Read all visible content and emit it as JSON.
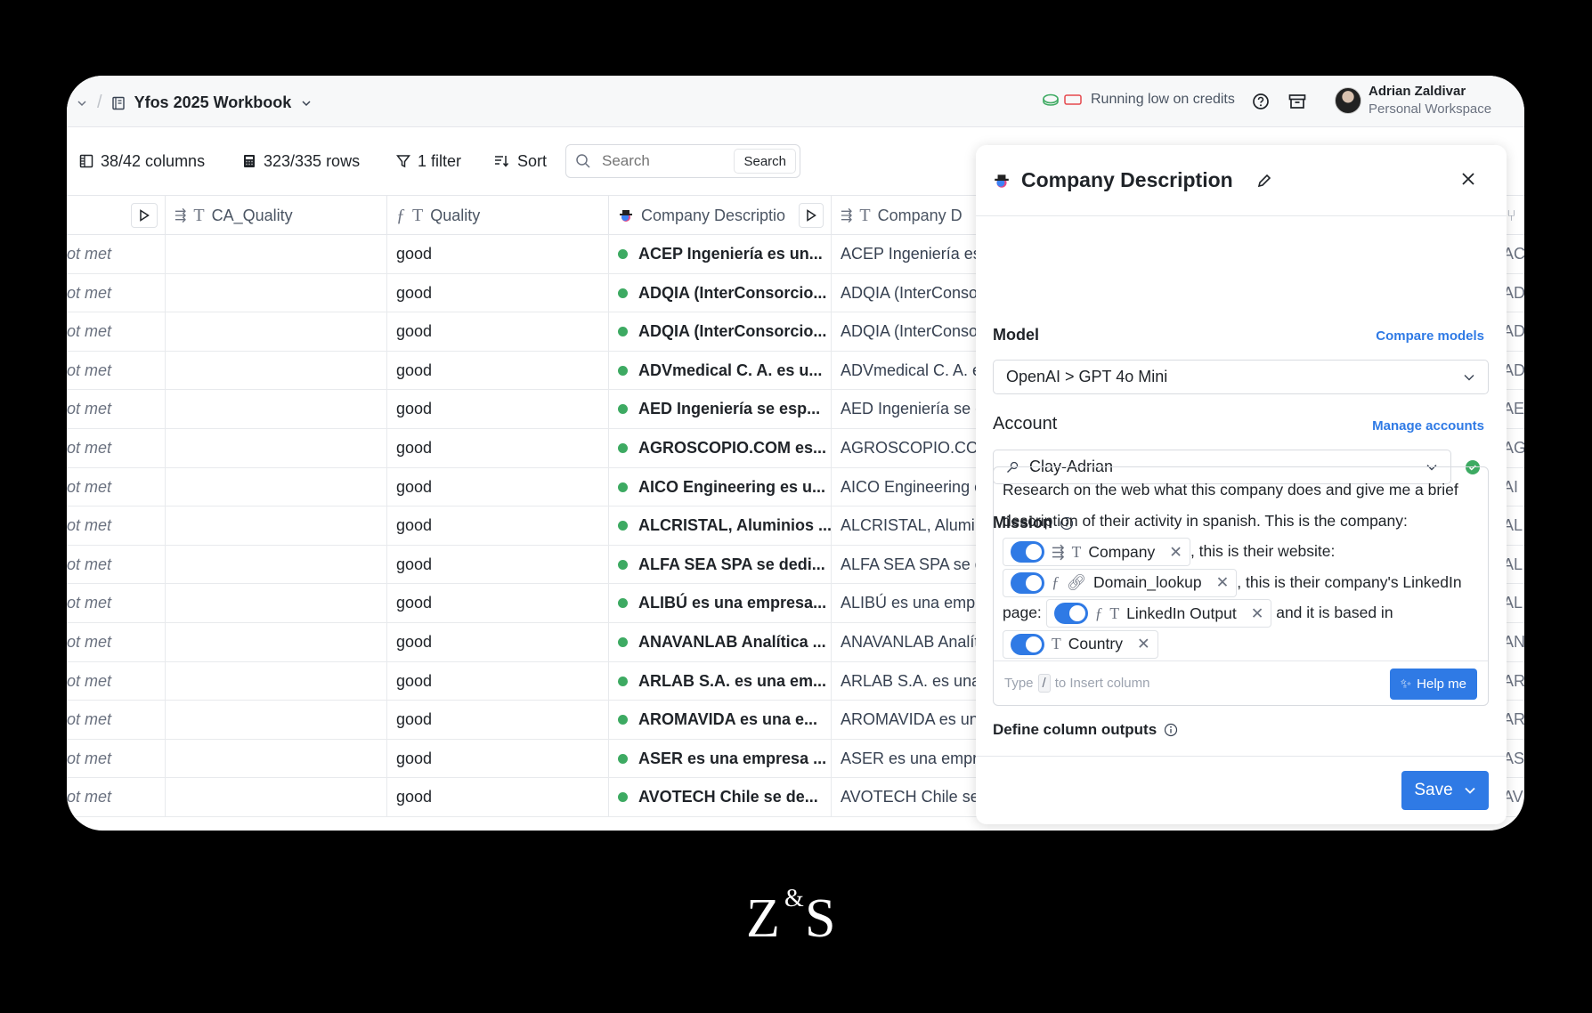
{
  "header": {
    "workbook_title": "Yfos 2025 Workbook",
    "credits_text": "Running low on credits",
    "user_name": "Adrian Zaldivar",
    "workspace": "Personal Workspace"
  },
  "toolbar": {
    "columns": "38/42 columns",
    "rows": "323/335 rows",
    "filter": "1 filter",
    "sort": "Sort",
    "search_placeholder": "Search",
    "search_button": "Search"
  },
  "table": {
    "headers": [
      "CA_Quality",
      "Quality",
      "Company Descriptio",
      "Company D"
    ],
    "rows": [
      {
        "status": "Not met",
        "ca_quality": "",
        "quality": "good",
        "description": "ACEP Ingeniería es un...",
        "company_d": "ACEP Ingeniería es",
        "last": "AC"
      },
      {
        "status": "Not met",
        "ca_quality": "",
        "quality": "good",
        "description": "ADQIA (InterConsorcio...",
        "company_d": "ADQIA (InterConso",
        "last": "AD"
      },
      {
        "status": "Not met",
        "ca_quality": "",
        "quality": "good",
        "description": "ADQIA (InterConsorcio...",
        "company_d": "ADQIA (InterConso",
        "last": "AD"
      },
      {
        "status": "Not met",
        "ca_quality": "",
        "quality": "good",
        "description": "ADVmedical C. A. es u...",
        "company_d": "ADVmedical C. A. e",
        "last": "AD"
      },
      {
        "status": "Not met",
        "ca_quality": "",
        "quality": "good",
        "description": "AED Ingeniería se esp...",
        "company_d": "AED Ingeniería se e",
        "last": "AE"
      },
      {
        "status": "Not met",
        "ca_quality": "",
        "quality": "good",
        "description": "AGROSCOPIO.COM es...",
        "company_d": "AGROSCOPIO.COM",
        "last": "AG"
      },
      {
        "status": "Not met",
        "ca_quality": "",
        "quality": "good",
        "description": "AICO Engineering es u...",
        "company_d": "AICO Engineering e",
        "last": "AI"
      },
      {
        "status": "Not met",
        "ca_quality": "",
        "quality": "good",
        "description": "ALCRISTAL, Aluminios ...",
        "company_d": "ALCRISTAL, Alumin",
        "last": "AL"
      },
      {
        "status": "Not met",
        "ca_quality": "",
        "quality": "good",
        "description": "ALFA SEA SPA se dedi...",
        "company_d": "ALFA SEA SPA se d",
        "last": "AL"
      },
      {
        "status": "Not met",
        "ca_quality": "",
        "quality": "good",
        "description": "ALIBÚ es una empresa...",
        "company_d": "ALIBÚ es una empr",
        "last": "AL"
      },
      {
        "status": "Not met",
        "ca_quality": "",
        "quality": "good",
        "description": "ANAVANLAB Analítica ...",
        "company_d": "ANAVANLAB Analít",
        "last": "AN"
      },
      {
        "status": "Not met",
        "ca_quality": "",
        "quality": "good",
        "description": "ARLAB S.A. es una em...",
        "company_d": "ARLAB S.A. es una",
        "last": "AR"
      },
      {
        "status": "Not met",
        "ca_quality": "",
        "quality": "good",
        "description": "AROMAVIDA es una e...",
        "company_d": "AROMAVIDA es un",
        "last": "AR"
      },
      {
        "status": "Not met",
        "ca_quality": "",
        "quality": "good",
        "description": "ASER es una empresa ...",
        "company_d": "ASER es una empr",
        "last": "AS"
      },
      {
        "status": "Not met",
        "ca_quality": "",
        "quality": "good",
        "description": "AVOTECH Chile se de...",
        "company_d": "AVOTECH Chile se",
        "last": "AV"
      }
    ]
  },
  "panel": {
    "title": "Company Description",
    "model_label": "Model",
    "compare_models": "Compare models",
    "model_value": "OpenAI > GPT 4o Mini",
    "account_label": "Account",
    "manage_accounts": "Manage accounts",
    "account_value": "Clay-Adrian",
    "mission_label": "Mission",
    "mission": {
      "t1": "Research on the web what this company does and give me a brief description of their activity in spanish. This is the company:",
      "chip1": "Company",
      "t2": ", this is their website:",
      "chip2": "Domain_lookup",
      "t3": ", this is their company's LinkedIn page:",
      "chip3": "LinkedIn Output",
      "t4": " and it is based in",
      "chip4": "Country"
    },
    "insert_hint_pre": "Type",
    "insert_hint_key": "/",
    "insert_hint_post": "to Insert column",
    "help_me": "Help me",
    "define_outputs": "Define column outputs",
    "save": "Save"
  },
  "colors": {
    "accent": "#2f7ae5",
    "status_green": "#3daa62"
  },
  "logo": "Z&S"
}
